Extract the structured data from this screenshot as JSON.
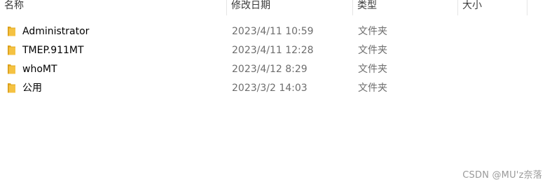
{
  "columns": {
    "name": "名称",
    "date": "修改日期",
    "type": "类型",
    "size": "大小"
  },
  "rows": [
    {
      "name": "Administrator",
      "date": "2023/4/11 10:59",
      "type": "文件夹",
      "icon": "folder-icon"
    },
    {
      "name": "TMEP.911MT",
      "date": "2023/4/11 12:28",
      "type": "文件夹",
      "icon": "folder-icon"
    },
    {
      "name": "whoMT",
      "date": "2023/4/12 8:29",
      "type": "文件夹",
      "icon": "folder-icon"
    },
    {
      "name": "公用",
      "date": "2023/3/2 14:03",
      "type": "文件夹",
      "icon": "folder-icon"
    }
  ],
  "watermark": "CSDN @MU'z奈落",
  "colors": {
    "folder_main": "#f5c242",
    "folder_dark": "#e0a820",
    "secondary_text": "#6d6d6d"
  }
}
